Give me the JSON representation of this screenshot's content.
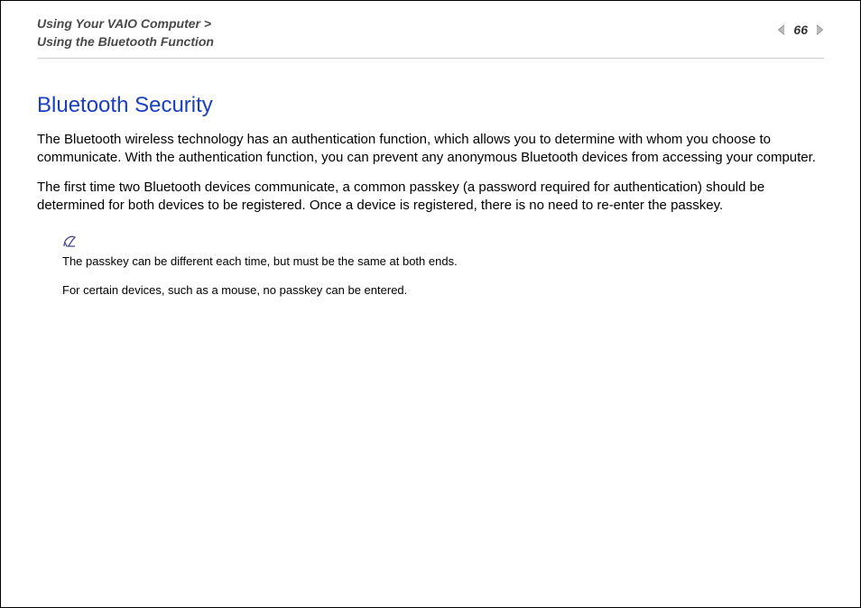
{
  "header": {
    "breadcrumb_line1": "Using Your VAIO Computer >",
    "breadcrumb_line2": "Using the Bluetooth Function",
    "page_number": "66"
  },
  "content": {
    "title": "Bluetooth Security",
    "paragraph1": "The Bluetooth wireless technology has an authentication function, which allows you to determine with whom you choose to communicate. With the authentication function, you can prevent any anonymous Bluetooth devices from accessing your computer.",
    "paragraph2": "The first time two Bluetooth devices communicate, a common passkey (a password required for authentication) should be determined for both devices to be registered. Once a device is registered, there is no need to re-enter the passkey.",
    "note1": "The passkey can be different each time, but must be the same at both ends.",
    "note2": "For certain devices, such as a mouse, no passkey can be entered."
  }
}
